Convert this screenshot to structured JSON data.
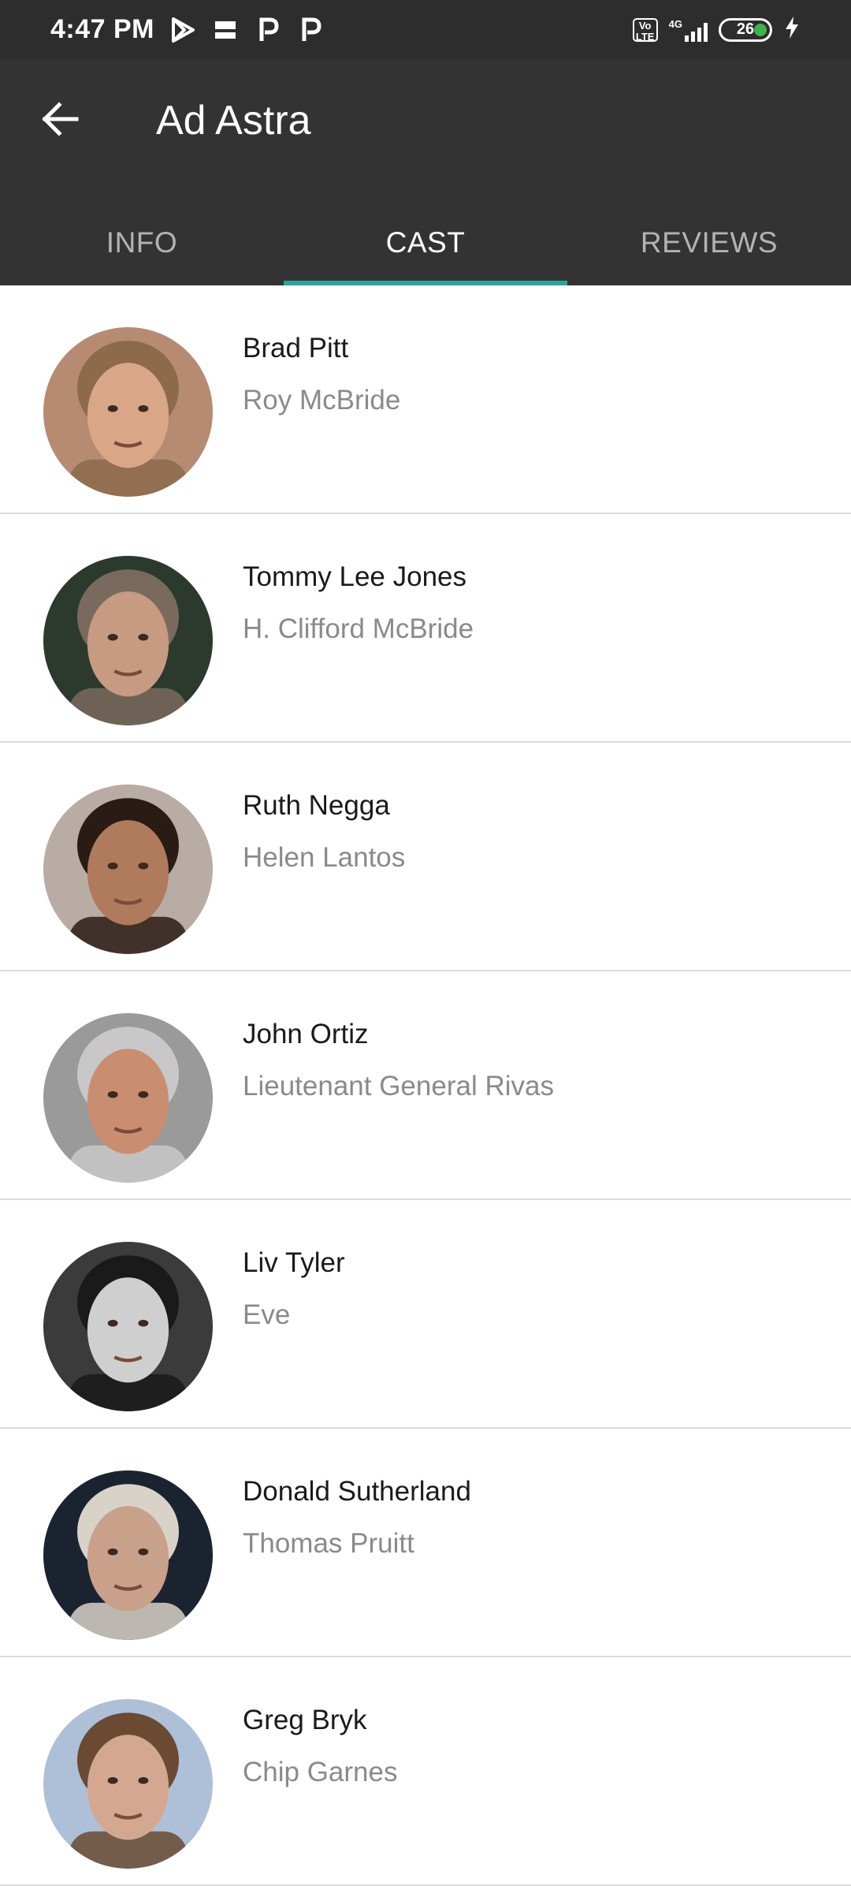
{
  "status_bar": {
    "time": "4:47 PM",
    "notification_icons": [
      "play-store-icon",
      "news-app-icon",
      "p-icon",
      "p-icon"
    ],
    "volte": "Vo LTE",
    "network": "4G",
    "battery": "26"
  },
  "app_bar": {
    "title": "Ad Astra",
    "back_icon": "arrow-left-icon"
  },
  "tabs": [
    {
      "label": "INFO",
      "active": false
    },
    {
      "label": "CAST",
      "active": true
    },
    {
      "label": "REVIEWS",
      "active": false
    }
  ],
  "cast": [
    {
      "actor": "Brad Pitt",
      "character": "Roy McBride",
      "avatar_bg": "#b78a72",
      "skin": "#d9a688",
      "hair": "#8c6a4a"
    },
    {
      "actor": "Tommy Lee Jones",
      "character": "H. Clifford McBride",
      "avatar_bg": "#2c3a2e",
      "skin": "#c79a82",
      "hair": "#7a6a5e"
    },
    {
      "actor": "Ruth Negga",
      "character": "Helen Lantos",
      "avatar_bg": "#b9aca5",
      "skin": "#b07a5c",
      "hair": "#2a1b14"
    },
    {
      "actor": "John Ortiz",
      "character": "Lieutenant General Rivas",
      "avatar_bg": "#9a9a9a",
      "skin": "#c98e70",
      "hair": "#c8c8c8"
    },
    {
      "actor": "Liv Tyler",
      "character": "Eve",
      "avatar_bg": "#3b3b3b",
      "skin": "#cfcfcf",
      "hair": "#1a1a1a"
    },
    {
      "actor": "Donald Sutherland",
      "character": "Thomas Pruitt",
      "avatar_bg": "#1b2330",
      "skin": "#c9a08a",
      "hair": "#d8d2c8"
    },
    {
      "actor": "Greg Bryk",
      "character": "Chip Garnes",
      "avatar_bg": "#aec0d8",
      "skin": "#d4a890",
      "hair": "#6a4a32"
    }
  ],
  "colors": {
    "app_bar": "#333333",
    "status_bar": "#2d2d2d",
    "tab_indicator": "#26a69a",
    "divider": "#dcdcdc"
  }
}
